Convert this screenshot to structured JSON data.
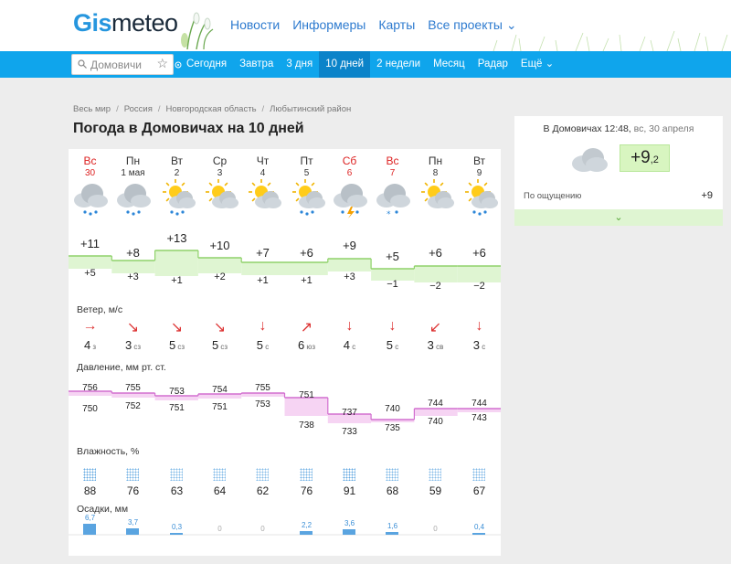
{
  "header": {
    "logo_g": "Gis",
    "logo_rest": "meteo",
    "nav": [
      "Новости",
      "Информеры",
      "Карты",
      "Все проекты ⌄"
    ]
  },
  "navbar": {
    "search_value": "Домовичи",
    "items": [
      "Сегодня",
      "Завтра",
      "3 дня",
      "10 дней",
      "2 недели",
      "Месяц",
      "Радар",
      "Ещё ⌄"
    ],
    "active_index": 3
  },
  "breadcrumbs": [
    "Весь мир",
    "Россия",
    "Новгородская область",
    "Любытинский район"
  ],
  "breadcrumb_sep": "/",
  "page_title": "Погода в Домовичах на 10 дней",
  "forecast": {
    "days": [
      {
        "dow": "Вс",
        "date": "30",
        "weekend": true,
        "icon": "cloud-rain-icon",
        "hi": "+11",
        "lo": "+5",
        "wind_dir": "→",
        "wind": "4",
        "wind_from": "з",
        "p_hi": "756",
        "p_lo": "750",
        "hum": "88",
        "prec": "6,7"
      },
      {
        "dow": "Пн",
        "date": "1 мая",
        "weekend": false,
        "icon": "cloud-rain-icon",
        "hi": "+8",
        "lo": "+3",
        "wind_dir": "↘",
        "wind": "3",
        "wind_from": "сз",
        "p_hi": "755",
        "p_lo": "752",
        "hum": "76",
        "prec": "3,7"
      },
      {
        "dow": "Вт",
        "date": "2",
        "weekend": false,
        "icon": "partly-sunny-rain-icon",
        "hi": "+13",
        "lo": "+1",
        "wind_dir": "↘",
        "wind": "5",
        "wind_from": "сз",
        "p_hi": "753",
        "p_lo": "751",
        "hum": "63",
        "prec": "0,3"
      },
      {
        "dow": "Ср",
        "date": "3",
        "weekend": false,
        "icon": "partly-sunny-icon",
        "hi": "+10",
        "lo": "+2",
        "wind_dir": "↘",
        "wind": "5",
        "wind_from": "сз",
        "p_hi": "754",
        "p_lo": "751",
        "hum": "64",
        "prec": "0"
      },
      {
        "dow": "Чт",
        "date": "4",
        "weekend": false,
        "icon": "partly-sunny-icon",
        "hi": "+7",
        "lo": "+1",
        "wind_dir": "↓",
        "wind": "5",
        "wind_from": "с",
        "p_hi": "755",
        "p_lo": "753",
        "hum": "62",
        "prec": "0"
      },
      {
        "dow": "Пт",
        "date": "5",
        "weekend": false,
        "icon": "partly-sunny-rain-icon",
        "hi": "+6",
        "lo": "+1",
        "wind_dir": "↗",
        "wind": "6",
        "wind_from": "юз",
        "p_hi": "751",
        "p_lo": "738",
        "hum": "76",
        "prec": "2,2"
      },
      {
        "dow": "Сб",
        "date": "6",
        "weekend": true,
        "icon": "thunderstorm-icon",
        "hi": "+9",
        "lo": "+3",
        "wind_dir": "↓",
        "wind": "4",
        "wind_from": "с",
        "p_hi": "737",
        "p_lo": "733",
        "hum": "91",
        "prec": "3,6"
      },
      {
        "dow": "Вс",
        "date": "7",
        "weekend": true,
        "icon": "cloud-snow-icon",
        "hi": "+5",
        "lo": "−1",
        "wind_dir": "↓",
        "wind": "5",
        "wind_from": "с",
        "p_hi": "740",
        "p_lo": "735",
        "hum": "68",
        "prec": "1,6"
      },
      {
        "dow": "Пн",
        "date": "8",
        "weekend": false,
        "icon": "partly-sunny-icon",
        "hi": "+6",
        "lo": "−2",
        "wind_dir": "↙",
        "wind": "3",
        "wind_from": "св",
        "p_hi": "744",
        "p_lo": "740",
        "hum": "59",
        "prec": "0"
      },
      {
        "dow": "Вт",
        "date": "9",
        "weekend": false,
        "icon": "partly-sunny-rain-icon",
        "hi": "+6",
        "lo": "−2",
        "wind_dir": "↓",
        "wind": "3",
        "wind_from": "с",
        "p_hi": "744",
        "p_lo": "743",
        "hum": "67",
        "prec": "0,4"
      }
    ],
    "labels": {
      "wind": "Ветер, м/с",
      "pressure": "Давление, мм рт. ст.",
      "humidity": "Влажность, %",
      "precip": "Осадки, мм"
    }
  },
  "now": {
    "place_time": "В Домовичах 12:48,",
    "date": "вс, 30 апреля",
    "temp_main": "+9",
    "temp_dec": ",2",
    "feels_label": "По ощущению",
    "feels_value": "+9",
    "expand": "⌄"
  },
  "colors": {
    "accent": "#0fa5ec",
    "active_nav": "#0b83c9",
    "temp_band": "#dff5d2",
    "temp_line": "#8fd26a",
    "pressure_band": "#f6d4f3",
    "pressure_line": "#d26fcf",
    "weekend_red": "#d22222"
  }
}
